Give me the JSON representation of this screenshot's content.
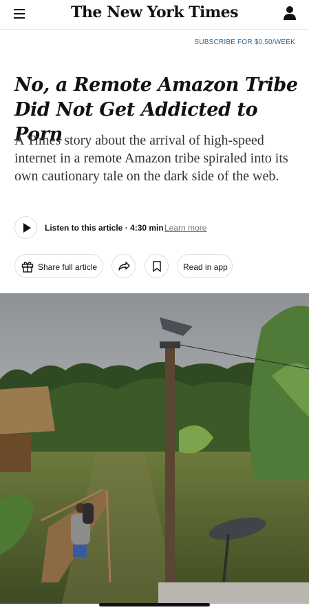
{
  "header": {
    "brand": "The New York Times",
    "subscribe": "SUBSCRIBE FOR $0.50/WEEK"
  },
  "article": {
    "headline": "No, a Remote Amazon Tribe Did Not Get Addicted to Porn",
    "summary": "A Times story about the arrival of high-speed internet in a remote Amazon tribe spiraled into its own cautionary tale on the dark side of the web."
  },
  "audio": {
    "listen_text": "Listen to this article · 4:30 min",
    "learn_more": "Learn more"
  },
  "actions": {
    "share_label": "Share full article",
    "read_in_app_label": "Read in app"
  },
  "icons": {
    "menu": "menu-icon",
    "user": "user-icon",
    "play": "play-icon",
    "gift": "gift-icon",
    "share": "forward-arrow-icon",
    "bookmark": "bookmark-icon"
  },
  "colors": {
    "link": "#326891",
    "text": "#121212",
    "border": "#dfdfdf"
  }
}
